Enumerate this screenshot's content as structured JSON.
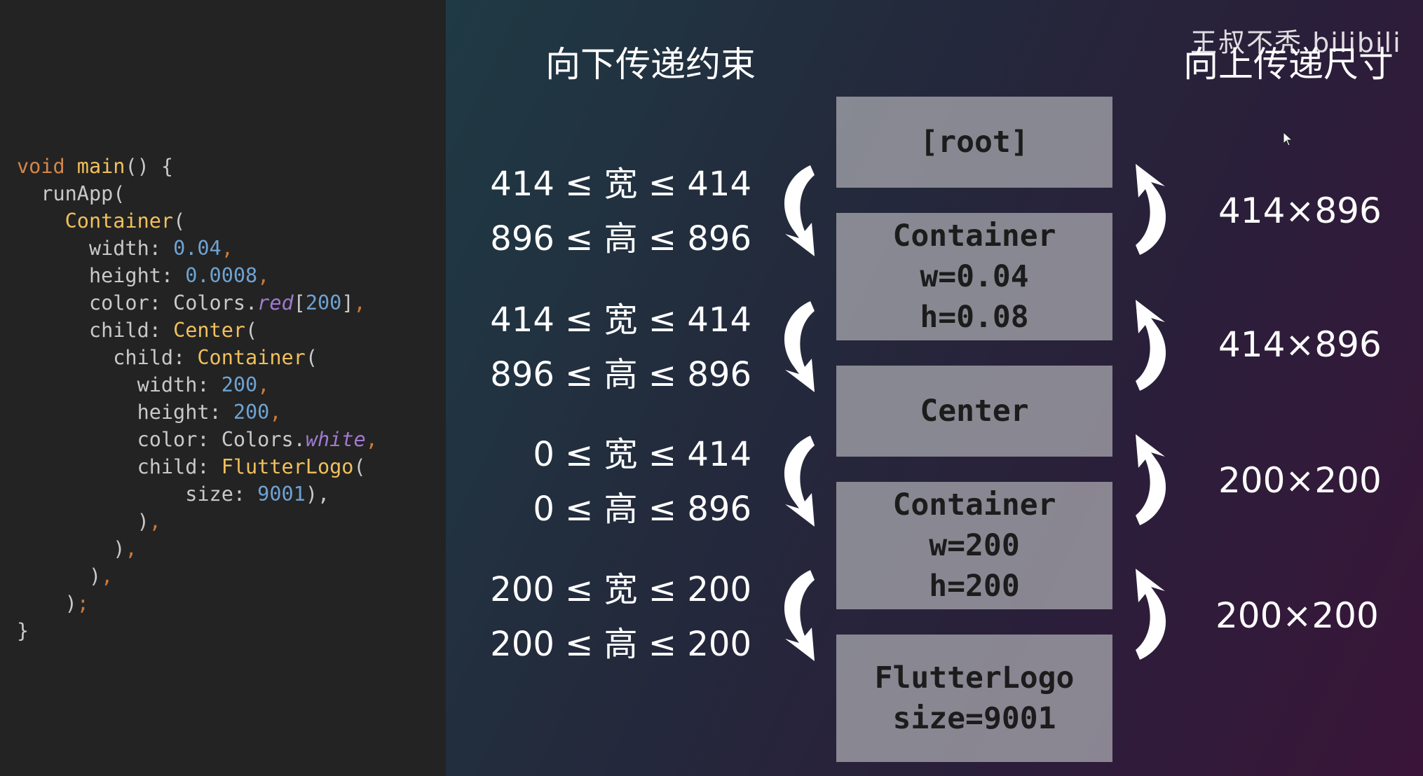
{
  "code": {
    "lines": [
      [
        {
          "t": "void ",
          "c": "kw"
        },
        {
          "t": "main",
          "c": "fn"
        },
        {
          "t": "() {",
          "c": ""
        }
      ],
      [
        {
          "t": "  runApp(",
          "c": ""
        }
      ],
      [
        {
          "t": "    ",
          "c": ""
        },
        {
          "t": "Container",
          "c": "cls"
        },
        {
          "t": "(",
          "c": ""
        }
      ],
      [
        {
          "t": "      width: ",
          "c": ""
        },
        {
          "t": "0.04",
          "c": "num"
        },
        {
          "t": ",",
          "c": "pn"
        }
      ],
      [
        {
          "t": "      height: ",
          "c": ""
        },
        {
          "t": "0.0008",
          "c": "num"
        },
        {
          "t": ",",
          "c": "pn"
        }
      ],
      [
        {
          "t": "      color: Colors.",
          "c": ""
        },
        {
          "t": "red",
          "c": "it"
        },
        {
          "t": "[",
          "c": ""
        },
        {
          "t": "200",
          "c": "num"
        },
        {
          "t": "]",
          "c": ""
        },
        {
          "t": ",",
          "c": "pn"
        }
      ],
      [
        {
          "t": "      child: ",
          "c": ""
        },
        {
          "t": "Center",
          "c": "cls"
        },
        {
          "t": "(",
          "c": ""
        }
      ],
      [
        {
          "t": "        child: ",
          "c": ""
        },
        {
          "t": "Container",
          "c": "cls"
        },
        {
          "t": "(",
          "c": ""
        }
      ],
      [
        {
          "t": "          width: ",
          "c": ""
        },
        {
          "t": "200",
          "c": "num"
        },
        {
          "t": ",",
          "c": "pn"
        }
      ],
      [
        {
          "t": "          height: ",
          "c": ""
        },
        {
          "t": "200",
          "c": "num"
        },
        {
          "t": ",",
          "c": "pn"
        }
      ],
      [
        {
          "t": "          color: Colors.",
          "c": ""
        },
        {
          "t": "white",
          "c": "it"
        },
        {
          "t": ",",
          "c": "pn"
        }
      ],
      [
        {
          "t": "          child: ",
          "c": ""
        },
        {
          "t": "FlutterLogo",
          "c": "cls"
        },
        {
          "t": "(",
          "c": ""
        }
      ],
      [
        {
          "t": "              size: ",
          "c": ""
        },
        {
          "t": "9001",
          "c": "num"
        },
        {
          "t": "),",
          "c": ""
        },
        {
          "t": "",
          "c": "pn"
        }
      ],
      [
        {
          "t": "          )",
          "c": ""
        },
        {
          "t": ",",
          "c": "pn"
        }
      ],
      [
        {
          "t": "        )",
          "c": ""
        },
        {
          "t": ",",
          "c": "pn"
        }
      ],
      [
        {
          "t": "      )",
          "c": ""
        },
        {
          "t": ",",
          "c": "pn"
        }
      ],
      [
        {
          "t": "    )",
          "c": ""
        },
        {
          "t": ";",
          "c": "pn"
        }
      ],
      [
        {
          "t": "}",
          "c": ""
        }
      ]
    ]
  },
  "headings": {
    "down": "向下传递约束",
    "up": "向上传递尺寸"
  },
  "watermark": "王叔不秃 bilibili",
  "constraints": [
    {
      "line1": "414 ≤ 宽 ≤ 414",
      "line2": "896 ≤ 高 ≤ 896"
    },
    {
      "line1": "414 ≤ 宽 ≤ 414",
      "line2": "896 ≤ 高 ≤ 896"
    },
    {
      "line1": "0 ≤ 宽 ≤ 414",
      "line2": "0 ≤ 高 ≤ 896"
    },
    {
      "line1": "200 ≤ 宽 ≤ 200",
      "line2": "200 ≤ 高 ≤ 200"
    }
  ],
  "boxes": [
    {
      "lines": [
        "[root]"
      ]
    },
    {
      "lines": [
        "Container",
        "w=0.04",
        "h=0.08"
      ]
    },
    {
      "lines": [
        "Center"
      ]
    },
    {
      "lines": [
        "Container",
        "w=200",
        "h=200"
      ]
    },
    {
      "lines": [
        "FlutterLogo",
        "size=9001"
      ]
    }
  ],
  "sizes": [
    "414×896",
    "414×896",
    "200×200",
    "200×200"
  ],
  "colors": {
    "box_fill": "#afafb4",
    "arrow": "#ffffff",
    "code_bg": "#232323"
  }
}
